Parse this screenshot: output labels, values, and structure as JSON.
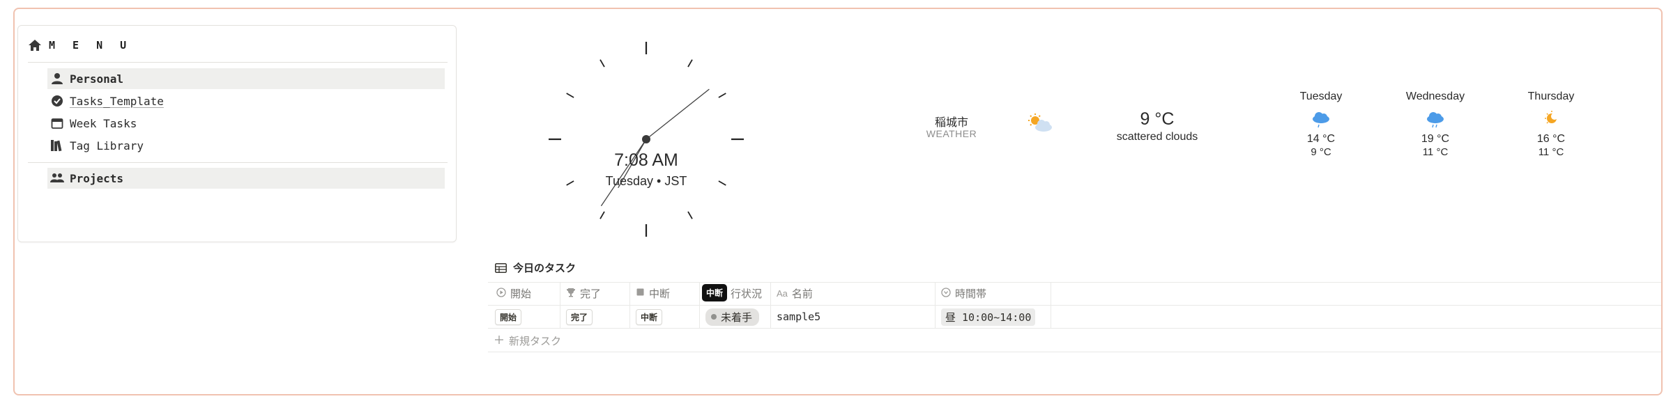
{
  "menu": {
    "title": "M E N U",
    "items": [
      {
        "label": "Personal",
        "icon": "user-icon"
      },
      {
        "label": "Tasks_Template",
        "icon": "check-badge-icon"
      },
      {
        "label": "Week Tasks",
        "icon": "calendar-icon"
      },
      {
        "label": "Tag Library",
        "icon": "books-icon"
      },
      {
        "label": "Projects",
        "icon": "users-icon"
      }
    ]
  },
  "clock": {
    "time": "7:08 AM",
    "date": "Tuesday • JST",
    "hour": 7,
    "minute": 8,
    "second": 35
  },
  "weather": {
    "city": "稲城市",
    "subtitle": "WEATHER",
    "current_icon": "sun-behind-cloud-icon",
    "temp": "9 °C",
    "description": "scattered clouds",
    "forecast": [
      {
        "day": "Tuesday",
        "icon": "rain-cloud-icon",
        "high": "14 °C",
        "low": "9 °C"
      },
      {
        "day": "Wednesday",
        "icon": "rain-cloud-icon",
        "high": "19 °C",
        "low": "11 °C"
      },
      {
        "day": "Thursday",
        "icon": "sun-moon-icon",
        "high": "16 °C",
        "low": "11 °C"
      }
    ]
  },
  "tasks": {
    "title": "今日のタスク",
    "columns": [
      "開始",
      "完了",
      "中断",
      "行状況",
      "名前",
      "時間帯"
    ],
    "tooltip": "中断",
    "rows": [
      {
        "start": "開始",
        "done": "完了",
        "pause": "中断",
        "status": "未着手",
        "name": "sample5",
        "timeslot": "昼 10:00~14:00"
      }
    ],
    "new_task": "新規タスク"
  },
  "colors": {
    "frame": "#f0c2b0",
    "rain": "#4c9be8",
    "sun": "#f5a623",
    "chip_bg": "#e3e2e0"
  }
}
